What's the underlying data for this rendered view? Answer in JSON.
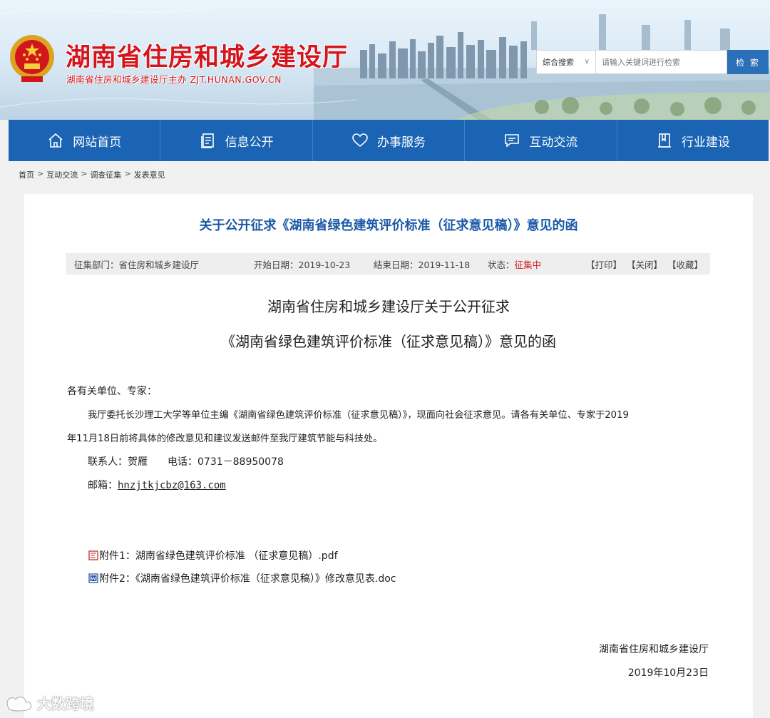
{
  "header": {
    "site_title": "湖南省住房和城乡建设厅",
    "site_subtitle": "湖南省住房和城乡建设厅主办 ZJT.HUNAN.GOV.CN",
    "search": {
      "scope": "综合搜索",
      "placeholder": "请输入关键词进行检索",
      "button": "检 索"
    }
  },
  "nav": {
    "items": [
      {
        "label": "网站首页",
        "icon": "home-icon"
      },
      {
        "label": "信息公开",
        "icon": "document-icon"
      },
      {
        "label": "办事服务",
        "icon": "heart-icon"
      },
      {
        "label": "互动交流",
        "icon": "chat-icon"
      },
      {
        "label": "行业建设",
        "icon": "book-icon"
      }
    ]
  },
  "breadcrumb": {
    "items": [
      "首页",
      "互动交流",
      "调查征集",
      "发表意见"
    ],
    "sep1": ">",
    "sep2": ">",
    "sep3": ">"
  },
  "article": {
    "title": "关于公开征求《湖南省绿色建筑评价标准（征求意见稿）》意见的函",
    "meta": {
      "dept": "征集部门：省住房和城乡建设厅",
      "start": "开始日期：2019-10-23",
      "end": "结束日期：2019-11-18",
      "status_label": "状态：",
      "status_value": "征集中",
      "print": "【打印】",
      "close": "【关闭】",
      "favorite": "【收藏】"
    },
    "doc_title_line1": "湖南省住房和城乡建设厅关于公开征求",
    "doc_title_line2": "《湖南省绿色建筑评价标准（征求意见稿）》意见的函",
    "salutation": "各有关单位、专家：",
    "paragraph_line1": "我厅委托长沙理工大学等单位主编《湖南省绿色建筑评价标准（征求意见稿）》，现面向社会征求意见。请各有关单位、专家于2019",
    "paragraph_line2": "年11月18日前将具体的修改意见和建议发送邮件至我厅建筑节能与科技处。",
    "contact": "联系人：贺雁　　电话：0731－88950078",
    "email_label": "邮箱：",
    "email": "hnzjtkjcbz@163.com",
    "attachments": [
      {
        "label": "附件1：湖南省绿色建筑评价标准 （征求意见稿）.pdf",
        "icon": "pdf-icon"
      },
      {
        "label": "附件2：《湖南省绿色建筑评价标准（征求意见稿）》修改意见表.doc",
        "icon": "word-icon"
      }
    ],
    "signature": "湖南省住房和城乡建设厅",
    "date": "2019年10月23日"
  },
  "watermark": "大数跨境"
}
